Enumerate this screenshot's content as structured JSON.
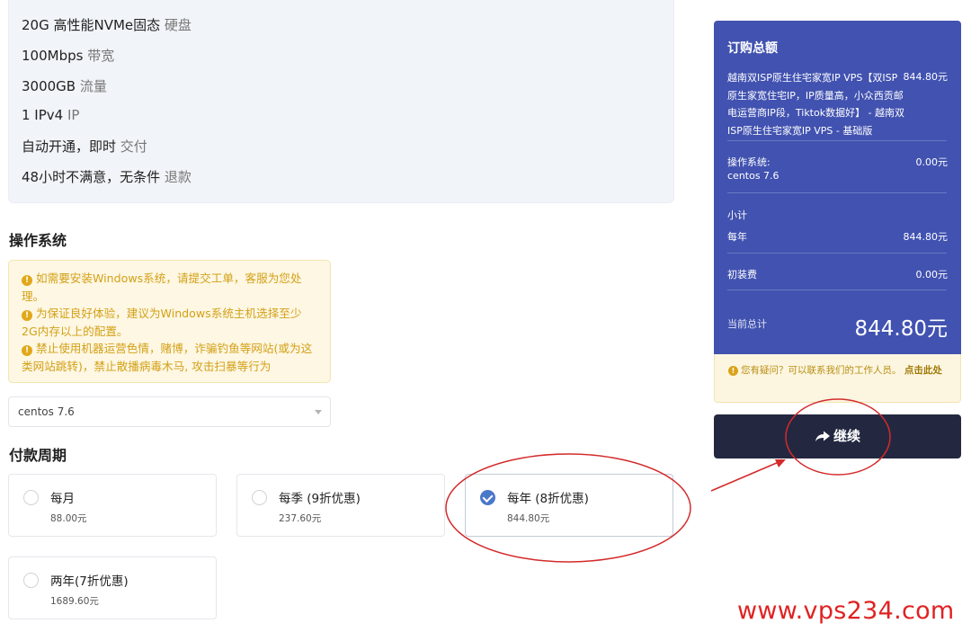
{
  "features": [
    {
      "bold": "20G 高性能NVMe固态",
      "muted": "硬盘"
    },
    {
      "bold": "100Mbps",
      "muted": "带宽"
    },
    {
      "bold": "3000GB",
      "muted": "流量"
    },
    {
      "bold": "1 IPv4",
      "muted": "IP"
    },
    {
      "bold": "自动开通，即时",
      "muted": "交付"
    },
    {
      "bold": "48小时不满意，无条件",
      "muted": "退款"
    }
  ],
  "os_section": {
    "title": "操作系统",
    "alerts": [
      "如需要安装Windows系统，请提交工单，客服为您处理。",
      "为保证良好体验，建议为Windows系统主机选择至少2G内存以上的配置。",
      "禁止使用机器运营色情，赌博，诈骗钓鱼等网站(或为这类网站跳转)，禁止散播病毒木马, 攻击扫暴等行为"
    ],
    "selected_os": "centos 7.6"
  },
  "billing_section": {
    "title": "付款周期",
    "options": [
      {
        "name": "每月",
        "price": "88.00元",
        "checked": false
      },
      {
        "name": "每季 (9折优惠)",
        "price": "237.60元",
        "checked": false
      },
      {
        "name": "每年 (8折优惠)",
        "price": "844.80元",
        "checked": true
      },
      {
        "name": "两年(7折优惠)",
        "price": "1689.60元",
        "checked": false
      }
    ]
  },
  "summary": {
    "title": "订购总额",
    "product": "越南双ISP原生住宅家宽IP VPS【双ISP原生家宽住宅IP，IP质量高，小众西贡邮电运营商IP段，Tiktok数据好】 - 越南双ISP原生住宅家宽IP VPS - 基础版",
    "product_price": "844.80元",
    "os_label": "操作系统:",
    "os_value": "centos 7.6",
    "os_price": "0.00元",
    "subtotal_label": "小计",
    "yearly_label": "每年",
    "yearly_price": "844.80元",
    "setup_label": "初装费",
    "setup_price": "0.00元",
    "total_label": "当前总计",
    "total": "844.80元"
  },
  "help": {
    "text": "您有疑问？可以联系我们的工作人员。",
    "link": "点击此处"
  },
  "continue_label": "继续",
  "watermark": "www.vps234.com",
  "colors": {
    "summary_bg": "#4152b0",
    "continue_bg": "#232840",
    "alert_text": "#d4a017",
    "annotation": "#d42a2a",
    "radio_checked": "#4a78c9"
  },
  "icons": [
    "exclamation-circle-icon",
    "share-arrow-icon",
    "check-icon",
    "caret-down-icon"
  ]
}
